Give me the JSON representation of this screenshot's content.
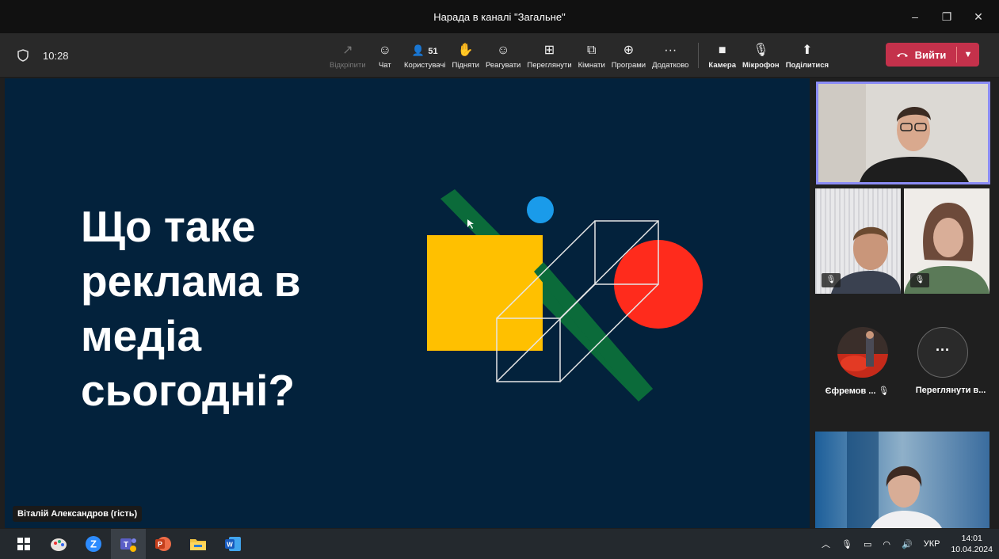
{
  "window": {
    "title": "Нарада в каналі \"Загальне\"",
    "controls": [
      "–",
      "❐",
      "✕"
    ]
  },
  "toolbar": {
    "time": "10:28",
    "items": [
      {
        "id": "unpin",
        "label": "Відкріпити",
        "icon": "↗",
        "disabled": true
      },
      {
        "id": "chat",
        "label": "Чат",
        "icon": "☺"
      },
      {
        "id": "people",
        "label": "Користувачі",
        "icon": "👤",
        "count": "51"
      },
      {
        "id": "raise",
        "label": "Підняти",
        "icon": "✋"
      },
      {
        "id": "react",
        "label": "Реагувати",
        "icon": "☺"
      },
      {
        "id": "view",
        "label": "Переглянути",
        "icon": "⊞"
      },
      {
        "id": "rooms",
        "label": "Кімнати",
        "icon": "⧉"
      },
      {
        "id": "apps",
        "label": "Програми",
        "icon": "⊕"
      },
      {
        "id": "more",
        "label": "Додатково",
        "icon": "···"
      }
    ],
    "media": [
      {
        "id": "camera",
        "label": "Камера",
        "icon": "■"
      },
      {
        "id": "mic",
        "label": "Мікрофон",
        "icon": "🎙"
      },
      {
        "id": "share",
        "label": "Поділитися",
        "icon": "⬆"
      }
    ],
    "leave_label": "Вийти"
  },
  "slide": {
    "title_lines": [
      "Що таке",
      "реклама в",
      "медіа",
      "сьогодні?"
    ],
    "colors": {
      "bg": "#03223c",
      "yellow": "#ffc000",
      "red": "#ff2b1c",
      "blue": "#1a9bea",
      "green": "#0b6b3a"
    }
  },
  "presenter_label": "Віталій Александров (гість)",
  "participants": {
    "name_1": "Єфремов ...",
    "view_more": "Переглянути в...",
    "more_icon": "···"
  },
  "taskbar": {
    "lang": "УКР",
    "time": "14:01",
    "date": "10.04.2024"
  }
}
